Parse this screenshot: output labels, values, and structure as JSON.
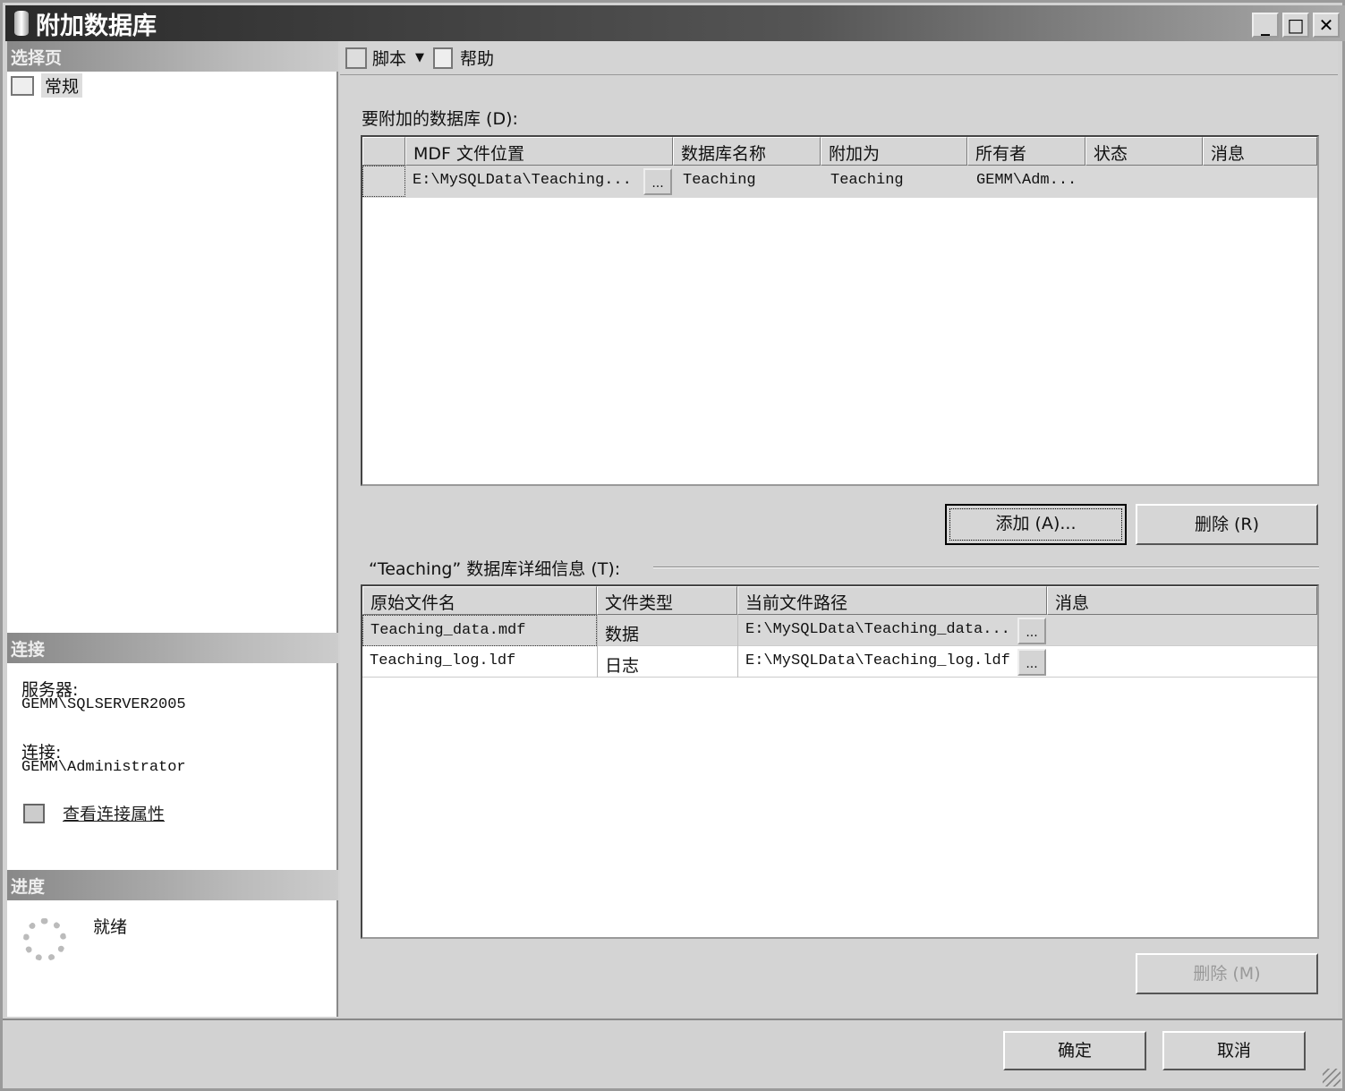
{
  "window": {
    "title": "附加数据库",
    "minimize": "_",
    "maximize": "□",
    "close": "✕"
  },
  "left": {
    "select_page_header": "选择页",
    "pages": [
      {
        "label": "常规",
        "icon": "general-page-icon"
      }
    ],
    "connection_header": "连接",
    "server_label": "服务器:",
    "server_value": "GEMM\\SQLSERVER2005",
    "connection_label": "连接:",
    "connection_value": "GEMM\\Administrator",
    "view_properties_link": "查看连接属性",
    "progress_header": "进度",
    "progress_status": "就绪"
  },
  "toolbar": {
    "script_label": "脚本",
    "help_label": "帮助"
  },
  "databases": {
    "label": "要附加的数据库 (D):",
    "columns": [
      "MDF 文件位置",
      "数据库名称",
      "附加为",
      "所有者",
      "状态",
      "消息"
    ],
    "rows": [
      {
        "mdf": "E:\\MySQLData\\Teaching...",
        "name": "Teaching",
        "attach_as": "Teaching",
        "owner": "GEMM\\Adm...",
        "status": "",
        "message": ""
      }
    ],
    "add_button": "添加 (A)...",
    "remove_button": "删除 (R)"
  },
  "details": {
    "label": "“Teaching” 数据库详细信息 (T):",
    "columns": [
      "原始文件名",
      "文件类型",
      "当前文件路径",
      "消息"
    ],
    "rows": [
      {
        "file": "Teaching_data.mdf",
        "type": "数据",
        "path": "E:\\MySQLData\\Teaching_data...",
        "message": ""
      },
      {
        "file": "Teaching_log.ldf",
        "type": "日志",
        "path": "E:\\MySQLData\\Teaching_log.ldf",
        "message": ""
      }
    ],
    "remove_button": "删除 (M)"
  },
  "footer": {
    "ok": "确定",
    "cancel": "取消"
  },
  "ellipsis": "..."
}
